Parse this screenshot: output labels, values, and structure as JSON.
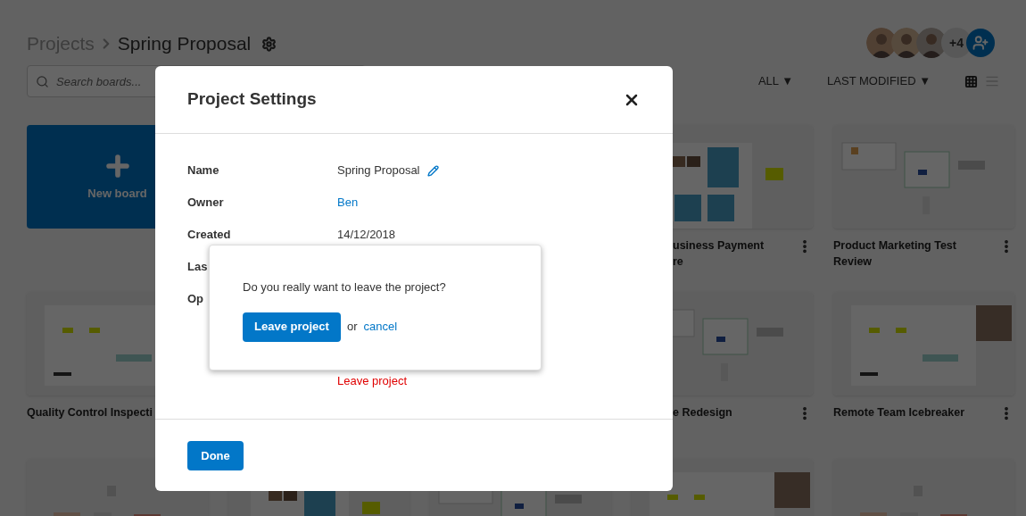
{
  "header": {
    "parent": "Projects",
    "title": "Spring Proposal"
  },
  "search": {
    "placeholder": "Search boards..."
  },
  "collaborators": {
    "extra_count": "+4"
  },
  "filters": {
    "scope": "ALL ▼",
    "sort": "LAST MODIFIED ▼"
  },
  "view_modes": [
    {
      "kind": "grid",
      "selected": true
    },
    {
      "kind": "list",
      "selected": false
    }
  ],
  "card_rows": [
    [
      {
        "kind": "new",
        "label": "New board"
      },
      {
        "kind": "board",
        "title_lines": [
          "usiness Payment",
          "re"
        ],
        "has_menu": true
      },
      {
        "kind": "board",
        "title_lines": [
          "Product Marketing Test",
          "Review"
        ],
        "has_menu": true
      }
    ],
    [
      {
        "kind": "board",
        "title_lines": [
          "Quality Control Inspecti"
        ],
        "has_menu": false
      },
      {
        "kind": "board",
        "title_lines": [
          "e Redesign"
        ],
        "has_menu": true
      },
      {
        "kind": "board",
        "title_lines": [
          "Remote Team Icebreaker"
        ],
        "has_menu": true
      }
    ],
    [
      {
        "kind": "board"
      },
      {
        "kind": "board"
      },
      {
        "kind": "board"
      },
      {
        "kind": "board"
      },
      {
        "kind": "board"
      }
    ]
  ],
  "modal": {
    "title": "Project Settings",
    "rows": [
      {
        "label": "Name",
        "value": "Spring Proposal",
        "kind": "editable"
      },
      {
        "label": "Owner",
        "value": "Ben",
        "kind": "link"
      },
      {
        "label": "Created",
        "value": "14/12/2018",
        "kind": "text"
      },
      {
        "label": "Las",
        "kind": "text"
      },
      {
        "label": "Op",
        "kind": "options",
        "action": "Leave project"
      }
    ],
    "done": "Done"
  },
  "confirm": {
    "question": "Do you really want to leave the project?",
    "confirm": "Leave project",
    "or": "or",
    "cancel": "cancel"
  }
}
